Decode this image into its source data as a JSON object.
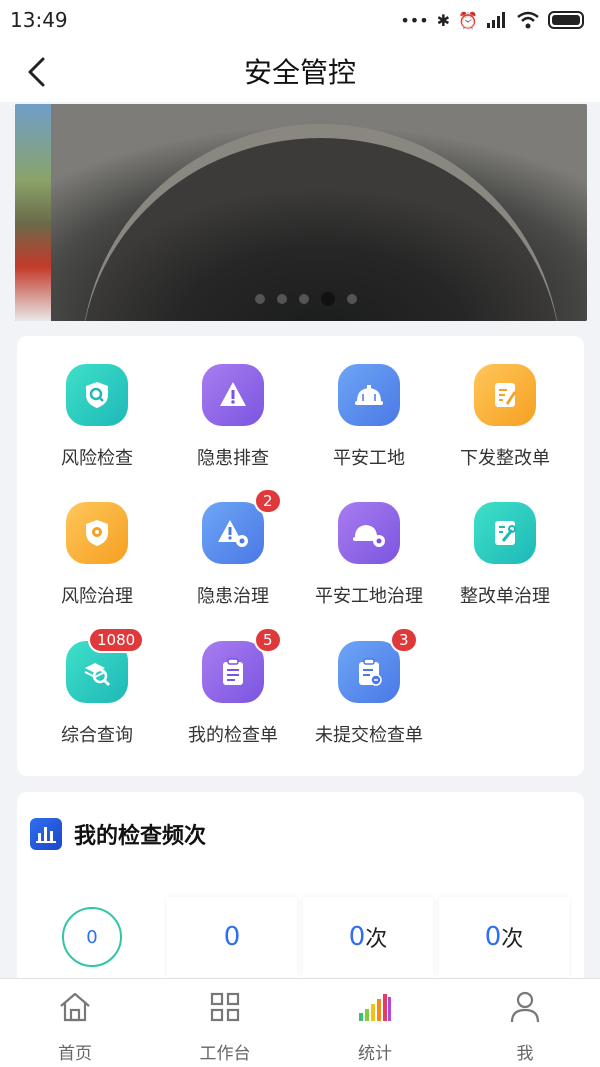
{
  "status_bar": {
    "time": "13:49"
  },
  "header": {
    "title": "安全管控"
  },
  "banner": {
    "dot_count": 5,
    "active_index": 3
  },
  "menu_items": [
    {
      "label": "风险检查",
      "icon": "shield-search-icon",
      "badge": ""
    },
    {
      "label": "隐患排查",
      "icon": "warning-icon",
      "badge": ""
    },
    {
      "label": "平安工地",
      "icon": "hard-hat-icon",
      "badge": ""
    },
    {
      "label": "下发整改单",
      "icon": "edit-document-icon",
      "badge": ""
    },
    {
      "label": "风险治理",
      "icon": "shield-gear-icon",
      "badge": ""
    },
    {
      "label": "隐患治理",
      "icon": "warning-gear-icon",
      "badge": "2"
    },
    {
      "label": "平安工地治理",
      "icon": "hard-hat-gear-icon",
      "badge": ""
    },
    {
      "label": "整改单治理",
      "icon": "wrench-document-icon",
      "badge": ""
    },
    {
      "label": "综合查询",
      "icon": "layers-search-icon",
      "badge": "1080"
    },
    {
      "label": "我的检查单",
      "icon": "clipboard-icon",
      "badge": "5"
    },
    {
      "label": "未提交检查单",
      "icon": "clipboard-pending-icon",
      "badge": "3"
    }
  ],
  "stats": {
    "title": "我的检查频次",
    "cells": [
      {
        "value": "0",
        "unit": ""
      },
      {
        "value": "0",
        "unit": ""
      },
      {
        "value": "0",
        "unit": "次"
      },
      {
        "value": "0",
        "unit": "次"
      }
    ]
  },
  "tabs": [
    {
      "label": "首页",
      "icon": "home-icon"
    },
    {
      "label": "工作台",
      "icon": "grid-icon"
    },
    {
      "label": "统计",
      "icon": "bar-chart-icon"
    },
    {
      "label": "我",
      "icon": "user-icon"
    }
  ],
  "colors": {
    "accent": "#2f6ff0",
    "badge": "#e0393b",
    "teal": "#2fc6a6"
  }
}
